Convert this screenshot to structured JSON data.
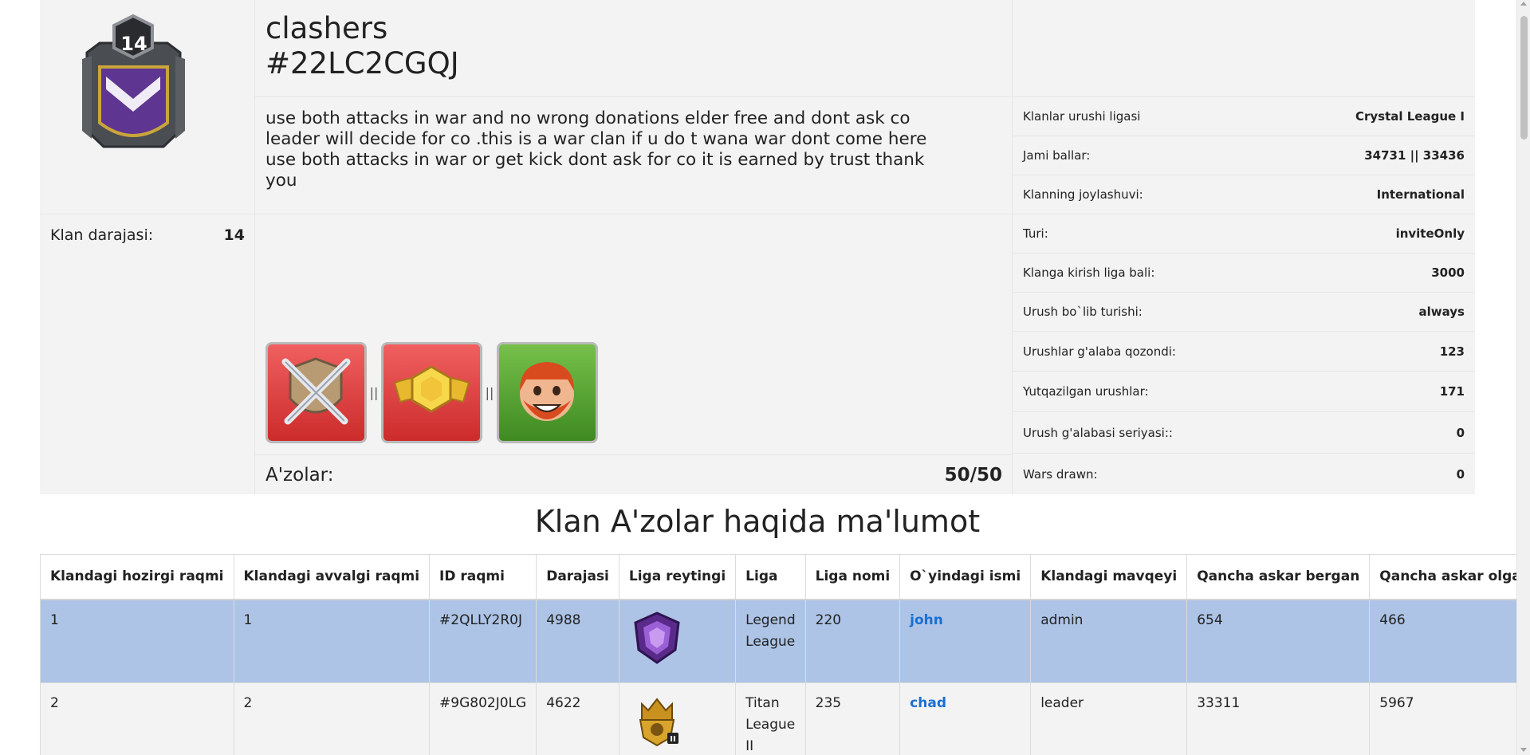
{
  "clan": {
    "name": "clashers",
    "tag": "#22LC2CGQJ",
    "badge_level": "14",
    "description": "use both attacks in war and no wrong donations elder free and dont ask co leader will decide for co .this is a war clan if u do t wana war dont come here use both attacks in war or get kick dont ask for co it is earned by trust thank you",
    "level_label": "Klan darajasi:",
    "level_value": "14",
    "members_label": "A'zolar:",
    "members_value": "50/50",
    "label_separator": "||"
  },
  "stats": [
    {
      "label": "Klanlar urushi ligasi",
      "value": "Crystal League I"
    },
    {
      "label": "Jami ballar:",
      "value": "34731 || 33436"
    },
    {
      "label": "Klanning joylashuvi:",
      "value": "International"
    },
    {
      "label": "Turi:",
      "value": "inviteOnly"
    },
    {
      "label": "Klanga kirish liga bali:",
      "value": "3000"
    },
    {
      "label": "Urush bo`lib turishi:",
      "value": "always"
    },
    {
      "label": "Urushlar g'alaba qozondi:",
      "value": "123"
    },
    {
      "label": "Yutqazilgan urushlar:",
      "value": "171"
    },
    {
      "label": "Urush g'alabasi seriyasi::",
      "value": "0"
    },
    {
      "label": "Wars drawn:",
      "value": "0"
    }
  ],
  "section_title": "Klan A'zolar haqida ma'lumot",
  "table": {
    "headers": [
      "Klandagi hozirgi raqmi",
      "Klandagi avvalgi raqmi",
      "ID raqmi",
      "Darajasi",
      "Liga reytingi",
      "Liga",
      "Liga nomi",
      "O`yindagi ismi",
      "Klandagi mavqeyi",
      "Qancha askar bergan",
      "Qancha askar olgan"
    ],
    "rows": [
      {
        "current": "1",
        "previous": "1",
        "id": "#2QLLY2R0J",
        "level": "4988",
        "league_icon": "legend-league-icon",
        "league": "Legend League",
        "league_name": "220",
        "name": "john",
        "role": "admin",
        "donated": "654",
        "received": "466"
      },
      {
        "current": "2",
        "previous": "2",
        "id": "#9G802J0LG",
        "level": "4622",
        "league_icon": "titan-league-icon",
        "league": "Titan League II",
        "league_name": "235",
        "name": "chad",
        "role": "leader",
        "donated": "33311",
        "received": "5967"
      }
    ]
  },
  "colors": {
    "row_highlight": "#adc4e6",
    "panel_bg": "#f2f3f2",
    "link": "#1a6fd2"
  }
}
